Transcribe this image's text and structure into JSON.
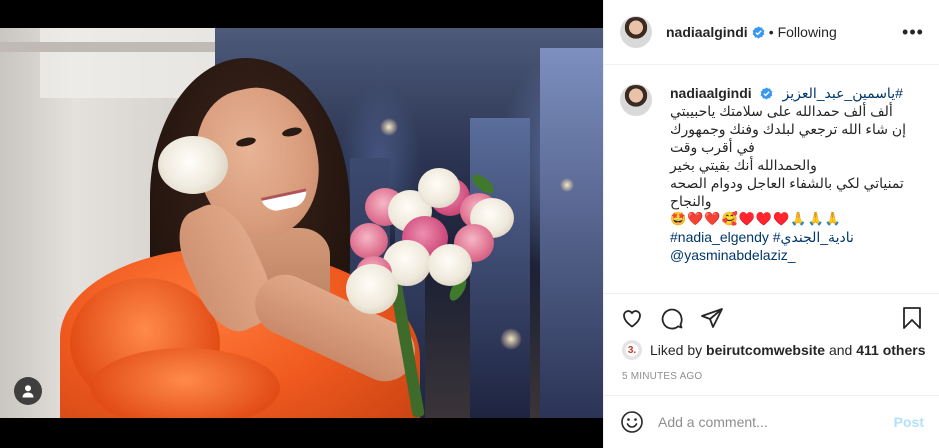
{
  "post": {
    "username": "nadiaalgindi",
    "follow_status": "Following",
    "dot": "•"
  },
  "caption": {
    "username": "nadiaalgindi",
    "hashtag_ar": "#ياسمين_عبد_العزيز",
    "lines": [
      "ألف ألف حمدالله على سلامتك ياحبيبتي",
      "إن شاء الله ترجعي لبلدك وفنك وجمهورك",
      "في أقرب وقت",
      "والحمدالله أنك بقيتي بخير",
      "تمنياتي لكي بالشفاء العاجل ودوام الصحه",
      "والنجاح"
    ],
    "emojis": "🤩❤️❤️🥰♥️♥️♥️🙏🙏🙏",
    "tags_line": "#nadia_elgendy #نادية_الجندي",
    "mention": "@yasminabdelaziz_"
  },
  "likes": {
    "prefix": "Liked by",
    "user": "beirutcomwebsite",
    "connector": "and",
    "count_text": "411 others"
  },
  "timestamp": "5 MINUTES AGO",
  "comment": {
    "placeholder": "Add a comment...",
    "post_label": "Post"
  },
  "icons": {
    "more": "more-horizontal-icon",
    "verified": "verified-badge-icon",
    "like": "heart-icon",
    "comment": "comment-bubble-icon",
    "share": "paper-plane-icon",
    "save": "bookmark-icon",
    "emoji": "smiley-icon",
    "tag": "person-tag-icon"
  },
  "colors": {
    "link": "#00376b",
    "verified": "#3897f0",
    "post_button_disabled": "#b2dffc",
    "muted": "#8e8e8e"
  }
}
